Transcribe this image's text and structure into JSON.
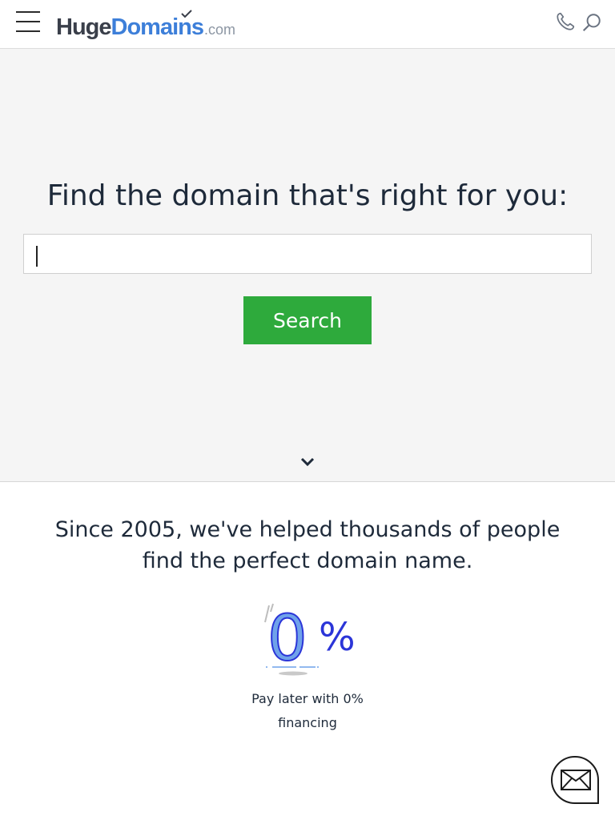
{
  "header": {
    "logo": {
      "part1": "Huge",
      "part2": "Domains",
      "part3": ".com"
    },
    "menu_icon": "hamburger-menu-icon",
    "phone_icon": "phone-icon",
    "search_icon": "search-icon"
  },
  "hero": {
    "title": "Find the domain that's right for you:",
    "search_input": {
      "value": "",
      "placeholder": ""
    },
    "search_button_label": "Search",
    "scroll_icon": "chevron-down-icon"
  },
  "about": {
    "tagline": "Since 2005, we've helped thousands of people find the perfect domain name.",
    "financing": {
      "graphic_digit": "0",
      "graphic_symbol": "%",
      "text": "Pay later with 0% financing"
    }
  },
  "contact": {
    "icon": "envelope-icon"
  },
  "colors": {
    "accent_green": "#2eaa3c",
    "brand_blue": "#3d7fd9",
    "zero_graphic_blue": "#2b35d8",
    "zero_graphic_light": "#6fa2ea",
    "text": "#1e2a3a"
  }
}
